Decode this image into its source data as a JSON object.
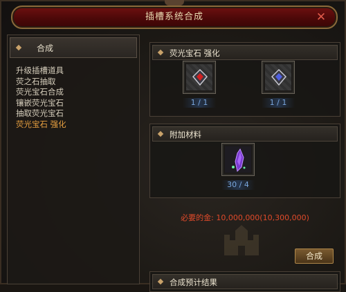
{
  "window": {
    "title": "插槽系统合成",
    "close_label": "✕"
  },
  "sidebar": {
    "header": "合成",
    "items": [
      {
        "label": "升级插槽道具",
        "active": false
      },
      {
        "label": "荧之石抽取",
        "active": false
      },
      {
        "label": "荧光宝石合成",
        "active": false
      },
      {
        "label": "镶嵌荧光宝石",
        "active": false
      },
      {
        "label": "抽取荧光宝石",
        "active": false
      },
      {
        "label": "荧光宝石 强化",
        "active": true
      }
    ]
  },
  "gem_panel": {
    "title": "荧光宝石 强化",
    "slots": [
      {
        "icon": "red-gem-icon",
        "count": "1 / 1"
      },
      {
        "icon": "blue-gem-icon",
        "count": "1 / 1"
      }
    ]
  },
  "material_panel": {
    "title": "附加材料",
    "slot": {
      "icon": "purple-crystal-icon",
      "count": "30 / 4"
    }
  },
  "cost": {
    "text": "必要的金: 10,000,000(10,300,000)"
  },
  "actions": {
    "combine_label": "合成"
  },
  "result_panel": {
    "title": "合成预计结果"
  },
  "colors": {
    "active_item": "#e8a040",
    "cost_text": "#e04a2a",
    "count_text": "#7aa8e0",
    "title_bar": "#6e1010"
  }
}
